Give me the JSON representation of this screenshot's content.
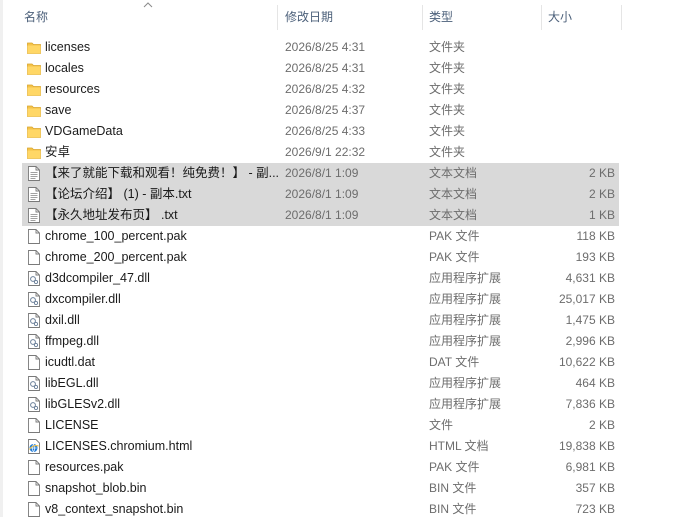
{
  "columns": {
    "name": "名称",
    "date": "修改日期",
    "type": "类型",
    "size": "大小"
  },
  "rows": [
    {
      "name": "licenses",
      "date": "2026/8/25 4:31",
      "type": "文件夹",
      "size": "",
      "icon": "folder-icon",
      "selected": false
    },
    {
      "name": "locales",
      "date": "2026/8/25 4:31",
      "type": "文件夹",
      "size": "",
      "icon": "folder-icon",
      "selected": false
    },
    {
      "name": "resources",
      "date": "2026/8/25 4:32",
      "type": "文件夹",
      "size": "",
      "icon": "folder-icon",
      "selected": false
    },
    {
      "name": "save",
      "date": "2026/8/25 4:37",
      "type": "文件夹",
      "size": "",
      "icon": "folder-icon",
      "selected": false
    },
    {
      "name": "VDGameData",
      "date": "2026/8/25 4:33",
      "type": "文件夹",
      "size": "",
      "icon": "folder-icon",
      "selected": false
    },
    {
      "name": "安卓",
      "date": "2026/9/1 22:32",
      "type": "文件夹",
      "size": "",
      "icon": "folder-icon",
      "selected": false
    },
    {
      "name": "【来了就能下载和观看！纯免费！】 - 副...",
      "date": "2026/8/1 1:09",
      "type": "文本文档",
      "size": "2 KB",
      "icon": "text-file-icon",
      "selected": true
    },
    {
      "name": "【论坛介绍】 (1) - 副本.txt",
      "date": "2026/8/1 1:09",
      "type": "文本文档",
      "size": "2 KB",
      "icon": "text-file-icon",
      "selected": true
    },
    {
      "name": "【永久地址发布页】 .txt",
      "date": "2026/8/1 1:09",
      "type": "文本文档",
      "size": "1 KB",
      "icon": "text-file-icon",
      "selected": true
    },
    {
      "name": "chrome_100_percent.pak",
      "date": "",
      "type": "PAK 文件",
      "size": "118 KB",
      "icon": "file-icon",
      "selected": false
    },
    {
      "name": "chrome_200_percent.pak",
      "date": "",
      "type": "PAK 文件",
      "size": "193 KB",
      "icon": "file-icon",
      "selected": false
    },
    {
      "name": "d3dcompiler_47.dll",
      "date": "",
      "type": "应用程序扩展",
      "size": "4,631 KB",
      "icon": "dll-file-icon",
      "selected": false
    },
    {
      "name": "dxcompiler.dll",
      "date": "",
      "type": "应用程序扩展",
      "size": "25,017 KB",
      "icon": "dll-file-icon",
      "selected": false
    },
    {
      "name": "dxil.dll",
      "date": "",
      "type": "应用程序扩展",
      "size": "1,475 KB",
      "icon": "dll-file-icon",
      "selected": false
    },
    {
      "name": "ffmpeg.dll",
      "date": "",
      "type": "应用程序扩展",
      "size": "2,996 KB",
      "icon": "dll-file-icon",
      "selected": false
    },
    {
      "name": "icudtl.dat",
      "date": "",
      "type": "DAT 文件",
      "size": "10,622 KB",
      "icon": "file-icon",
      "selected": false
    },
    {
      "name": "libEGL.dll",
      "date": "",
      "type": "应用程序扩展",
      "size": "464 KB",
      "icon": "dll-file-icon",
      "selected": false
    },
    {
      "name": "libGLESv2.dll",
      "date": "",
      "type": "应用程序扩展",
      "size": "7,836 KB",
      "icon": "dll-file-icon",
      "selected": false
    },
    {
      "name": "LICENSE",
      "date": "",
      "type": "文件",
      "size": "2 KB",
      "icon": "file-icon",
      "selected": false
    },
    {
      "name": "LICENSES.chromium.html",
      "date": "",
      "type": "HTML 文档",
      "size": "19,838 KB",
      "icon": "html-file-icon",
      "selected": false
    },
    {
      "name": "resources.pak",
      "date": "",
      "type": "PAK 文件",
      "size": "6,981 KB",
      "icon": "file-icon",
      "selected": false
    },
    {
      "name": "snapshot_blob.bin",
      "date": "",
      "type": "BIN 文件",
      "size": "357 KB",
      "icon": "file-icon",
      "selected": false
    },
    {
      "name": "v8_context_snapshot.bin",
      "date": "",
      "type": "BIN 文件",
      "size": "723 KB",
      "icon": "file-icon",
      "selected": false
    }
  ],
  "colors": {
    "selected_row": "#d9d9d9",
    "folder": "#f5c34a",
    "header_text": "#4c607a"
  }
}
